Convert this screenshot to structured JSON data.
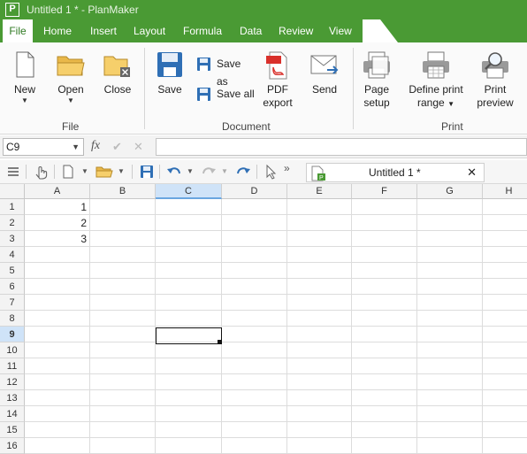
{
  "titlebar": {
    "icon_letter": "P",
    "title": "Untitled 1 * - PlanMaker"
  },
  "tabs": [
    "File",
    "Home",
    "Insert",
    "Layout",
    "Formula",
    "Data",
    "Review",
    "View"
  ],
  "ribbon": {
    "file_group": {
      "label": "File",
      "new": "New",
      "open": "Open",
      "close": "Close"
    },
    "document_group": {
      "label": "Document",
      "save": "Save",
      "save_as": "Save as",
      "save_all": "Save all",
      "pdf_export": [
        "PDF",
        "export"
      ],
      "send": "Send"
    },
    "print_group": {
      "label": "Print",
      "page_setup": [
        "Page",
        "setup"
      ],
      "define_print_range": [
        "Define print",
        "range"
      ],
      "print_preview": [
        "Print",
        "preview"
      ]
    }
  },
  "formula_bar": {
    "cell_ref": "C9",
    "fx": "fx",
    "confirm": "✔",
    "cancel": "✕",
    "value": ""
  },
  "toolbar": {
    "more": "»"
  },
  "document_tab": {
    "name": "Untitled 1 *",
    "close": "✕"
  },
  "sheet": {
    "columns": [
      "A",
      "B",
      "C",
      "D",
      "E",
      "F",
      "G",
      "H"
    ],
    "rows": [
      "1",
      "2",
      "3",
      "4",
      "5",
      "6",
      "7",
      "8",
      "9",
      "10",
      "11",
      "12",
      "13",
      "14",
      "15",
      "16"
    ],
    "selected_cell": "C9",
    "cells": {
      "A1": "1",
      "A2": "2",
      "A3": "3"
    }
  },
  "colors": {
    "accent": "#4a9a34",
    "selection": "#cfe3f8"
  }
}
